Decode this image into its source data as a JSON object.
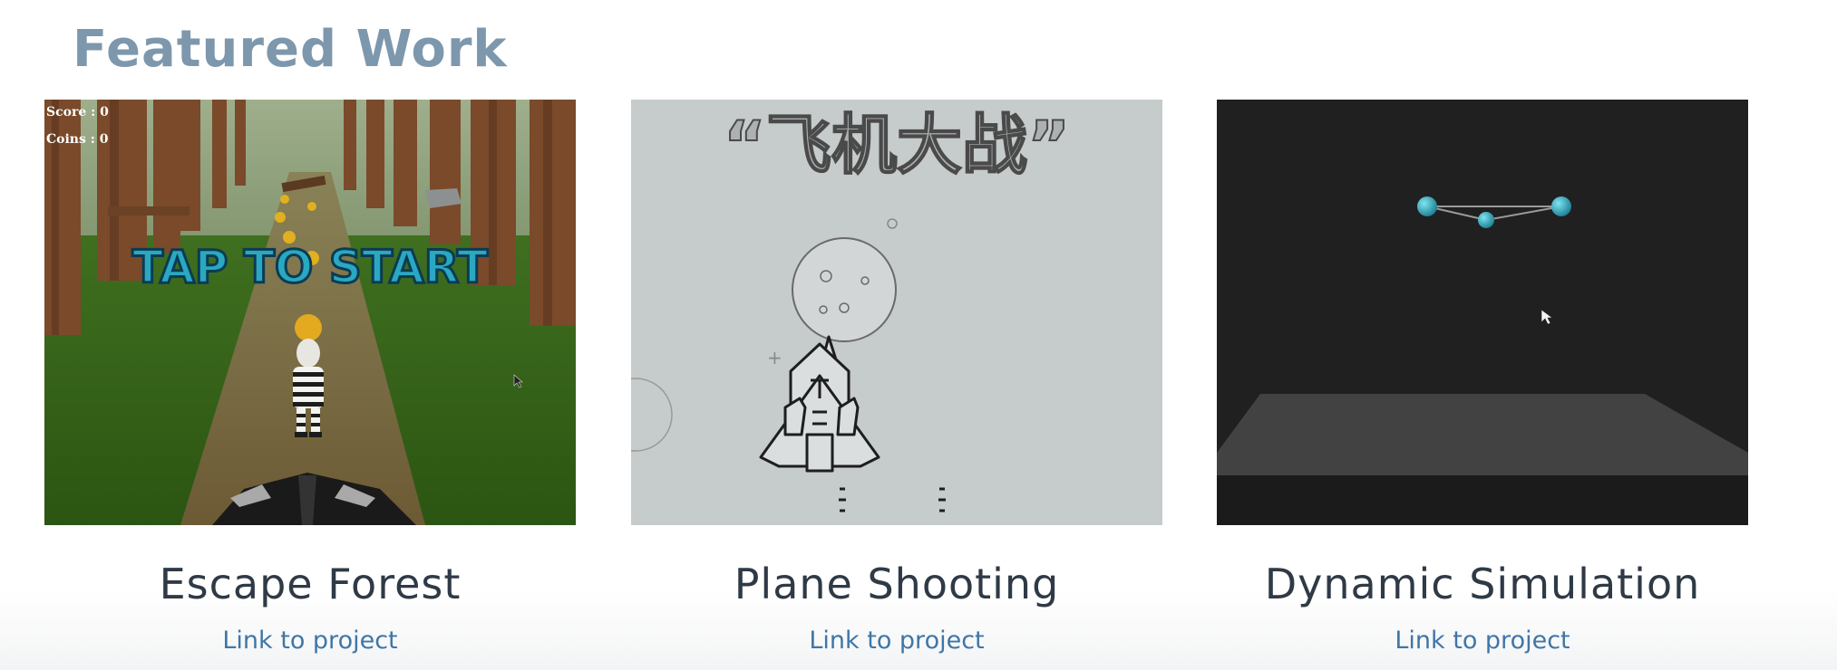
{
  "section": {
    "title": "Featured Work"
  },
  "projects": [
    {
      "title": "Escape Forest",
      "link_label": "Link to project",
      "screenshot": {
        "score_text": "Score : 0",
        "coins_text": "Coins : 0",
        "banner_text": "TAP TO START"
      }
    },
    {
      "title": "Plane Shooting",
      "link_label": "Link to project",
      "screenshot": {
        "banner_text": "“飞机大战”"
      }
    },
    {
      "title": "Dynamic Simulation",
      "link_label": "Link to project",
      "screenshot": {}
    }
  ],
  "colors": {
    "title": "#7d97ad",
    "card_title": "#2f3a46",
    "link": "#3f76a8"
  }
}
